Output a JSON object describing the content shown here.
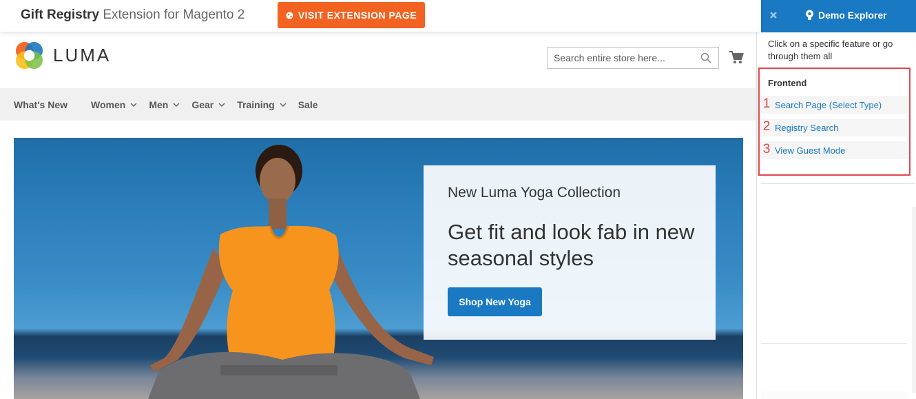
{
  "topbar": {
    "title_strong": "Gift Registry",
    "title_light": "Extension for Magento 2",
    "visit_button": "VISIT EXTENSION PAGE",
    "accent": "#f26322"
  },
  "header": {
    "logo_text": "LUMA",
    "search_placeholder": "Search entire store here..."
  },
  "nav": {
    "items": [
      {
        "label": "What's New",
        "dropdown": false
      },
      {
        "label": "Women",
        "dropdown": true
      },
      {
        "label": "Men",
        "dropdown": true
      },
      {
        "label": "Gear",
        "dropdown": true
      },
      {
        "label": "Training",
        "dropdown": true
      },
      {
        "label": "Sale",
        "dropdown": false
      }
    ]
  },
  "hero": {
    "subtitle": "New Luma Yoga Collection",
    "title": "Get fit and look fab in new seasonal styles",
    "button": "Shop New Yoga",
    "button_color": "#1979c3"
  },
  "demo_panel": {
    "title": "Demo Explorer",
    "description": "Click on a specific feature or go through them all",
    "section": "Frontend",
    "features": [
      {
        "num": "1",
        "label": "Search Page (Select Type)"
      },
      {
        "num": "2",
        "label": "Registry Search"
      },
      {
        "num": "3",
        "label": "View Guest Mode"
      }
    ],
    "header_color": "#1979c3",
    "highlight_color": "#e0474c"
  }
}
